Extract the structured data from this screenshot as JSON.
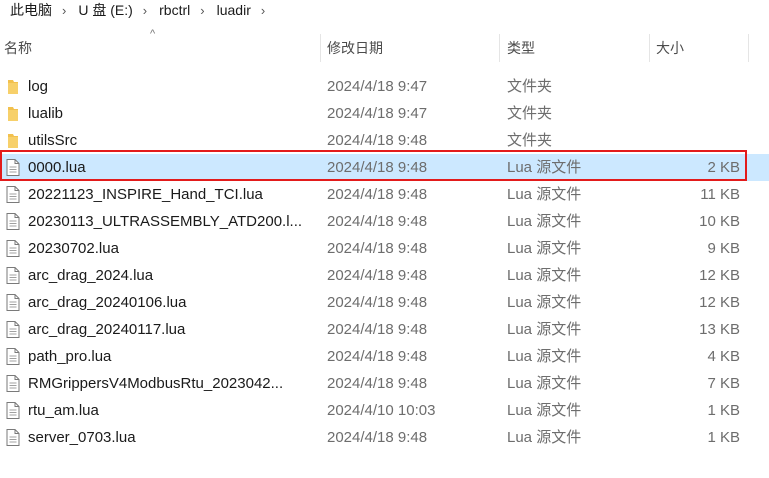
{
  "breadcrumb": [
    "此电脑",
    "U 盘 (E:)",
    "rbctrl",
    "luadir"
  ],
  "columns": {
    "name": "名称",
    "date": "修改日期",
    "type": "类型",
    "size": "大小"
  },
  "files": [
    {
      "name": "log",
      "date": "2024/4/18 9:47",
      "type": "文件夹",
      "size": "",
      "kind": "folder"
    },
    {
      "name": "lualib",
      "date": "2024/4/18 9:47",
      "type": "文件夹",
      "size": "",
      "kind": "folder"
    },
    {
      "name": "utilsSrc",
      "date": "2024/4/18 9:48",
      "type": "文件夹",
      "size": "",
      "kind": "folder"
    },
    {
      "name": "0000.lua",
      "date": "2024/4/18 9:48",
      "type": "Lua 源文件",
      "size": "2 KB",
      "kind": "file",
      "selected": true
    },
    {
      "name": "20221123_INSPIRE_Hand_TCI.lua",
      "date": "2024/4/18 9:48",
      "type": "Lua 源文件",
      "size": "11 KB",
      "kind": "file"
    },
    {
      "name": "20230113_ULTRASSEMBLY_ATD200.l...",
      "date": "2024/4/18 9:48",
      "type": "Lua 源文件",
      "size": "10 KB",
      "kind": "file"
    },
    {
      "name": "20230702.lua",
      "date": "2024/4/18 9:48",
      "type": "Lua 源文件",
      "size": "9 KB",
      "kind": "file"
    },
    {
      "name": "arc_drag_2024.lua",
      "date": "2024/4/18 9:48",
      "type": "Lua 源文件",
      "size": "12 KB",
      "kind": "file"
    },
    {
      "name": "arc_drag_20240106.lua",
      "date": "2024/4/18 9:48",
      "type": "Lua 源文件",
      "size": "12 KB",
      "kind": "file"
    },
    {
      "name": "arc_drag_20240117.lua",
      "date": "2024/4/18 9:48",
      "type": "Lua 源文件",
      "size": "13 KB",
      "kind": "file"
    },
    {
      "name": "path_pro.lua",
      "date": "2024/4/18 9:48",
      "type": "Lua 源文件",
      "size": "4 KB",
      "kind": "file"
    },
    {
      "name": "RMGrippersV4ModbusRtu_2023042...",
      "date": "2024/4/18 9:48",
      "type": "Lua 源文件",
      "size": "7 KB",
      "kind": "file"
    },
    {
      "name": "rtu_am.lua",
      "date": "2024/4/10 10:03",
      "type": "Lua 源文件",
      "size": "1 KB",
      "kind": "file"
    },
    {
      "name": "server_0703.lua",
      "date": "2024/4/18 9:48",
      "type": "Lua 源文件",
      "size": "1 KB",
      "kind": "file"
    }
  ],
  "colors": {
    "selection": "#cce8ff",
    "highlight_border": "#e31b1b",
    "folder": "#f2c14e"
  }
}
